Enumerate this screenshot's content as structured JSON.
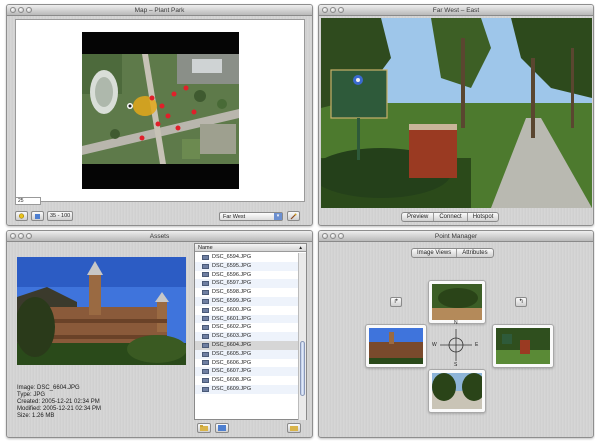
{
  "map_window": {
    "title": "Map – Plant Park",
    "zoom_value": "25",
    "toolbar": {
      "range_label": "35 - 100"
    },
    "location_select": "Far West"
  },
  "photo_window": {
    "title": "Far West – East",
    "tabs": [
      "Preview",
      "Connect",
      "Hotspot"
    ]
  },
  "assets_window": {
    "title": "Assets",
    "list_header": "Name",
    "files": [
      "DSC_6594.JPG",
      "DSC_6595.JPG",
      "DSC_6596.JPG",
      "DSC_6597.JPG",
      "DSC_6598.JPG",
      "DSC_6599.JPG",
      "DSC_6600.JPG",
      "DSC_6601.JPG",
      "DSC_6602.JPG",
      "DSC_6603.JPG",
      "DSC_6604.JPG",
      "DSC_6605.JPG",
      "DSC_6606.JPG",
      "DSC_6607.JPG",
      "DSC_6608.JPG",
      "DSC_6609.JPG"
    ],
    "selected_file": "DSC_6604.JPG",
    "info": {
      "image": "Image: DSC_6604.JPG",
      "type": "Type: JPG",
      "created": "Created: 2005-12-21 02:34 PM",
      "modified": "Modified: 2005-12-21 02:34 PM",
      "size": "Size: 1.26 MB"
    }
  },
  "point_manager": {
    "title": "Point Manager",
    "tabs": [
      "Image Views",
      "Attributes"
    ],
    "compass": {
      "n": "N",
      "s": "S",
      "e": "E",
      "w": "W"
    }
  },
  "colors": {
    "selection_row": "#d6d6d6",
    "alt_row": "#eef3fb",
    "map_marker": "#e0202a",
    "select_arrow": "#6b8fd0"
  }
}
